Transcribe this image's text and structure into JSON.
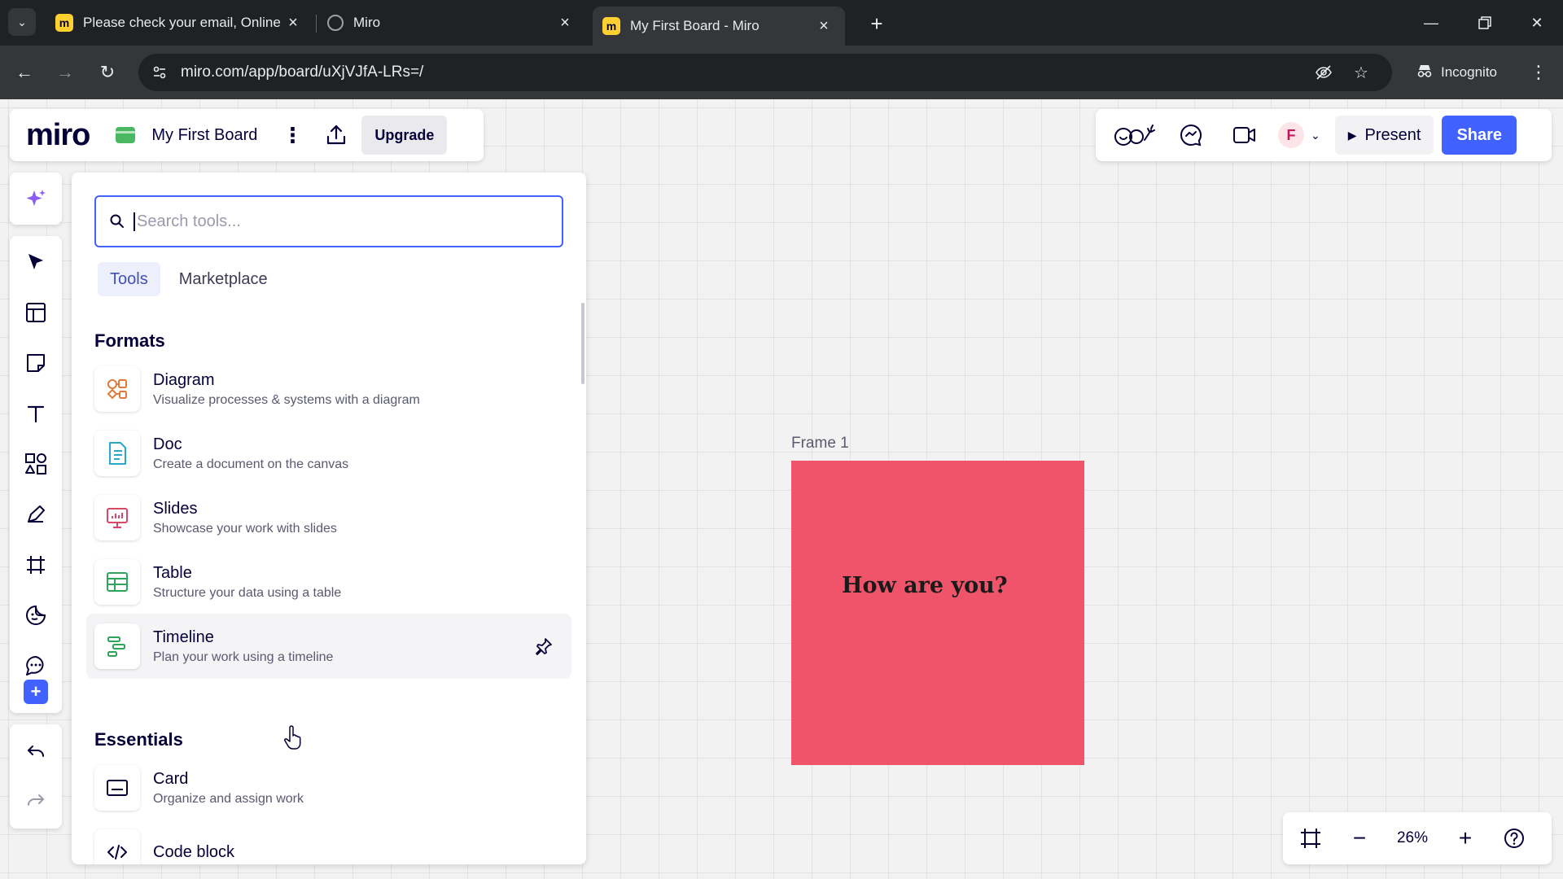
{
  "browser": {
    "tabs": [
      {
        "title": "Please check your email, Online",
        "favicon": "miro-icon",
        "active": false
      },
      {
        "title": "Miro",
        "favicon": "globe-icon",
        "active": false
      },
      {
        "title": "My First Board - Miro",
        "favicon": "miro-icon",
        "active": true
      }
    ],
    "url": "miro.com/app/board/uXjVJfA-LRs=/",
    "incognito_label": "Incognito"
  },
  "board": {
    "logo": "miro",
    "name": "My First Board",
    "upgrade_label": "Upgrade",
    "present_label": "Present",
    "share_label": "Share",
    "avatar_initial": "F"
  },
  "panel": {
    "search_placeholder": "Search tools...",
    "tabs": [
      "Tools",
      "Marketplace"
    ],
    "sections": [
      {
        "title": "Formats",
        "items": [
          {
            "name": "Diagram",
            "desc": "Visualize processes & systems with a diagram",
            "icon": "diagram-icon"
          },
          {
            "name": "Doc",
            "desc": "Create a document on the canvas",
            "icon": "doc-icon"
          },
          {
            "name": "Slides",
            "desc": "Showcase your work with slides",
            "icon": "slides-icon"
          },
          {
            "name": "Table",
            "desc": "Structure your data using a table",
            "icon": "table-icon"
          },
          {
            "name": "Timeline",
            "desc": "Plan your work using a timeline",
            "icon": "timeline-icon"
          }
        ]
      },
      {
        "title": "Essentials",
        "items": [
          {
            "name": "Card",
            "desc": "Organize and assign work",
            "icon": "card-icon"
          },
          {
            "name": "Code block",
            "desc": "",
            "icon": "code-block-icon"
          }
        ]
      }
    ]
  },
  "canvas": {
    "frame_label": "Frame 1",
    "frame_text": "How are you?",
    "frame_color": "#f0546a"
  },
  "zoom": {
    "value": "26%"
  },
  "colors": {
    "accent": "#4262ff",
    "brand_dark": "#050038"
  }
}
